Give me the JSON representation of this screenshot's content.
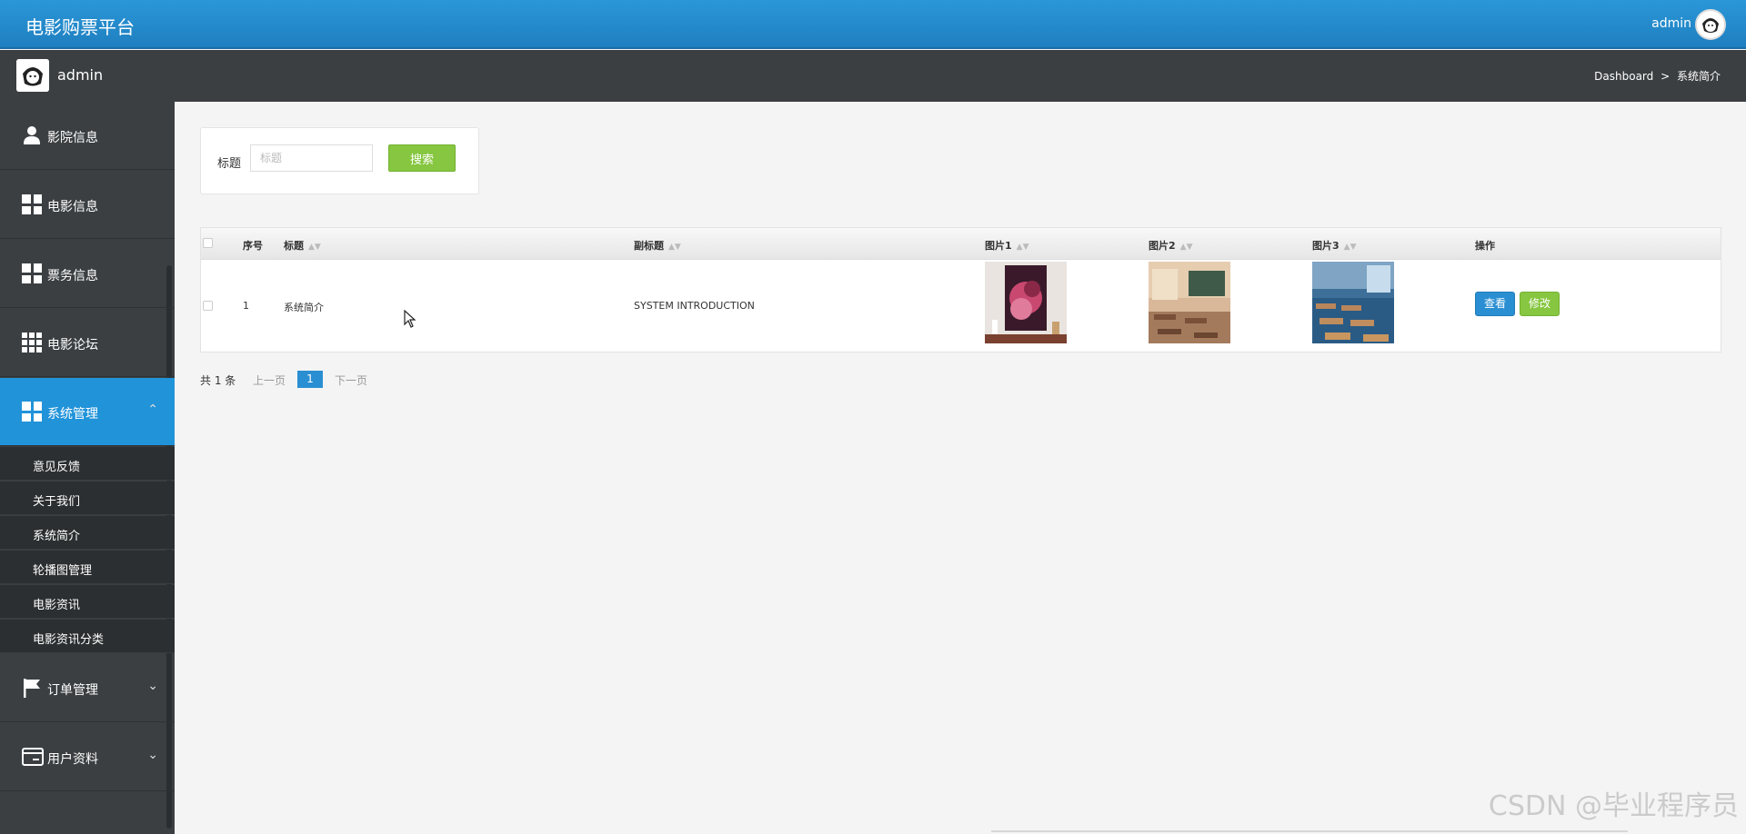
{
  "header": {
    "brand": "电影购票平台",
    "user": "admin"
  },
  "subheader": {
    "user": "admin",
    "breadcrumb": {
      "root": "Dashboard",
      "sep": ">",
      "current": "系统简介"
    }
  },
  "sidebar": {
    "items": [
      {
        "label": "影院信息",
        "icon": "user-icon"
      },
      {
        "label": "电影信息",
        "icon": "grid-icon"
      },
      {
        "label": "票务信息",
        "icon": "grid-icon"
      },
      {
        "label": "电影论坛",
        "icon": "grid9-icon"
      },
      {
        "label": "系统管理",
        "icon": "grid-icon",
        "active": true,
        "expanded": true
      },
      {
        "label": "订单管理",
        "icon": "flag-icon"
      },
      {
        "label": "用户资料",
        "icon": "card-icon"
      }
    ],
    "subitems": [
      "意见反馈",
      "关于我们",
      "系统简介",
      "轮播图管理",
      "电影资讯",
      "电影资讯分类"
    ]
  },
  "search": {
    "label": "标题",
    "placeholder": "标题",
    "button": "搜索"
  },
  "table": {
    "headers": {
      "index": "序号",
      "title": "标题",
      "subtitle": "副标题",
      "pic1": "图片1",
      "pic2": "图片2",
      "pic3": "图片3",
      "actions": "操作"
    },
    "rows": [
      {
        "index": "1",
        "title": "系统简介",
        "subtitle": "SYSTEM INTRODUCTION",
        "view": "查看",
        "edit": "修改"
      }
    ]
  },
  "pagination": {
    "total": "共 1 条",
    "prev": "上一页",
    "current": "1",
    "next": "下一页"
  },
  "watermark": "CSDN @毕业程序员",
  "colors": {
    "primary": "#2193d9",
    "success": "#86c640",
    "sidebar": "#3b3f42"
  }
}
